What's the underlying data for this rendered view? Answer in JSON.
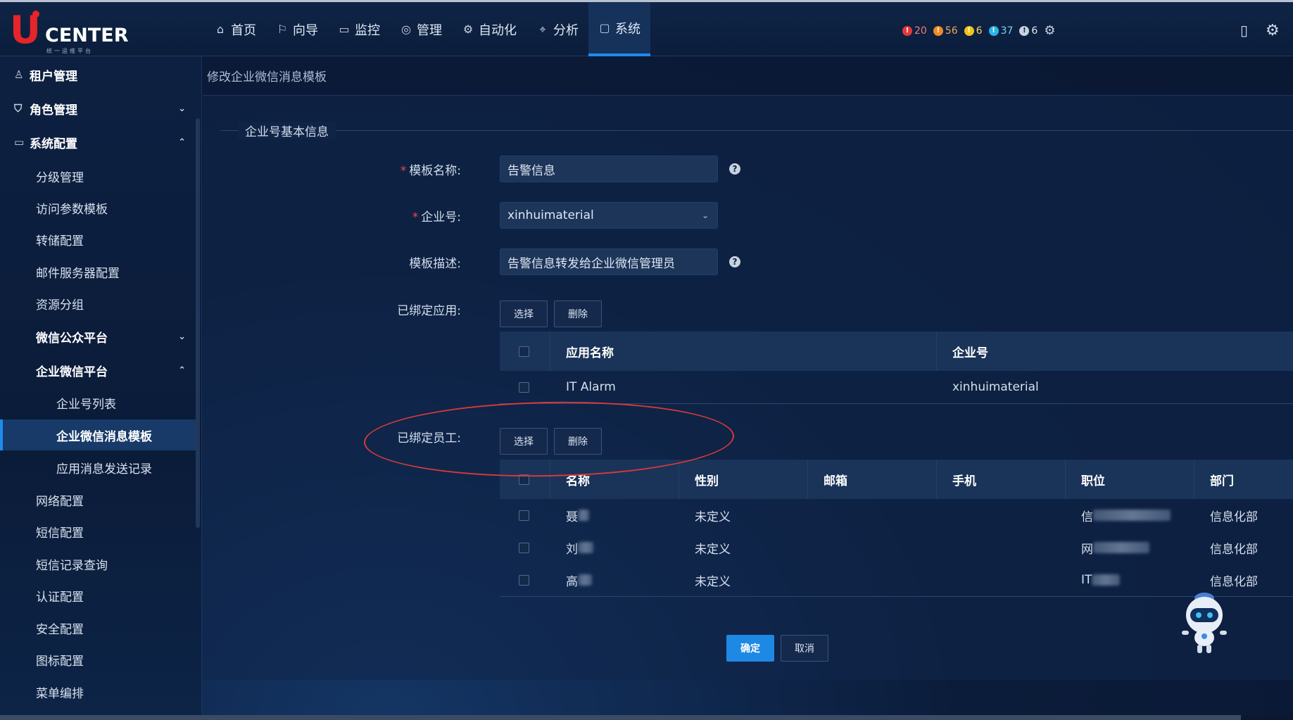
{
  "app": {
    "logo_letter": "U",
    "logo_text": "CENTER",
    "logo_sub": "统一运维平台"
  },
  "nav": [
    {
      "label": "首页",
      "icon": "home-icon"
    },
    {
      "label": "向导",
      "icon": "flag-icon"
    },
    {
      "label": "监控",
      "icon": "monitor-icon"
    },
    {
      "label": "管理",
      "icon": "manage-icon"
    },
    {
      "label": "自动化",
      "icon": "automation-icon"
    },
    {
      "label": "分析",
      "icon": "chart-icon"
    },
    {
      "label": "系统",
      "icon": "system-icon",
      "active": true
    }
  ],
  "alerts": [
    {
      "count": "20",
      "color": "#e5383b"
    },
    {
      "count": "56",
      "color": "#f08a24"
    },
    {
      "count": "6",
      "color": "#f2c21b"
    },
    {
      "count": "37",
      "color": "#2ab3e8"
    },
    {
      "count": "6",
      "color": "#c8d2e0"
    }
  ],
  "sidebar": {
    "items": [
      {
        "label": "租户管理",
        "level": 0,
        "icon": "user-icon"
      },
      {
        "label": "角色管理",
        "level": 0,
        "icon": "shield-icon",
        "chevron": "down"
      },
      {
        "label": "系统配置",
        "level": 0,
        "icon": "config-icon",
        "chevron": "up"
      },
      {
        "label": "分级管理",
        "level": 1
      },
      {
        "label": "访问参数模板",
        "level": 1
      },
      {
        "label": "转储配置",
        "level": 1
      },
      {
        "label": "邮件服务器配置",
        "level": 1
      },
      {
        "label": "资源分组",
        "level": 1
      },
      {
        "label": "微信公众平台",
        "level": 1,
        "bold": true,
        "chevron": "down"
      },
      {
        "label": "企业微信平台",
        "level": 1,
        "bold": true,
        "chevron": "up"
      },
      {
        "label": "企业号列表",
        "level": 2
      },
      {
        "label": "企业微信消息模板",
        "level": 2,
        "selected": true
      },
      {
        "label": "应用消息发送记录",
        "level": 2
      },
      {
        "label": "网络配置",
        "level": 1
      },
      {
        "label": "短信配置",
        "level": 1
      },
      {
        "label": "短信记录查询",
        "level": 1
      },
      {
        "label": "认证配置",
        "level": 1
      },
      {
        "label": "安全配置",
        "level": 1
      },
      {
        "label": "图标配置",
        "level": 1
      },
      {
        "label": "菜单编排",
        "level": 1
      }
    ]
  },
  "page": {
    "breadcrumb": "修改企业微信消息模板",
    "section_title": "企业号基本信息",
    "form": {
      "template_name_label": "模板名称:",
      "template_name_value": "告警信息",
      "corp_label": "企业号:",
      "corp_value": "xinhuimaterial",
      "desc_label": "模板描述:",
      "desc_value": "告警信息转发给企业微信管理员",
      "bound_apps_label": "已绑定应用:",
      "bound_staff_label": "已绑定员工:"
    },
    "buttons": {
      "select": "选择",
      "delete": "删除",
      "confirm": "确定",
      "cancel": "取消"
    },
    "apps_table": {
      "headers": [
        "应用名称",
        "企业号"
      ],
      "rows": [
        [
          "IT Alarm",
          "xinhuimaterial"
        ]
      ]
    },
    "staff_table": {
      "headers": [
        "名称",
        "性别",
        "邮箱",
        "手机",
        "职位",
        "部门"
      ],
      "rows": [
        {
          "name": "聂",
          "gender": "未定义",
          "email": "",
          "phone": "",
          "position": "信",
          "dept": "信息化部"
        },
        {
          "name": "刘",
          "gender": "未定义",
          "email": "",
          "phone": "",
          "position": "网",
          "dept": "信息化部"
        },
        {
          "name": "高",
          "gender": "未定义",
          "email": "",
          "phone": "",
          "position": "IT",
          "dept": "信息化部"
        }
      ]
    }
  }
}
